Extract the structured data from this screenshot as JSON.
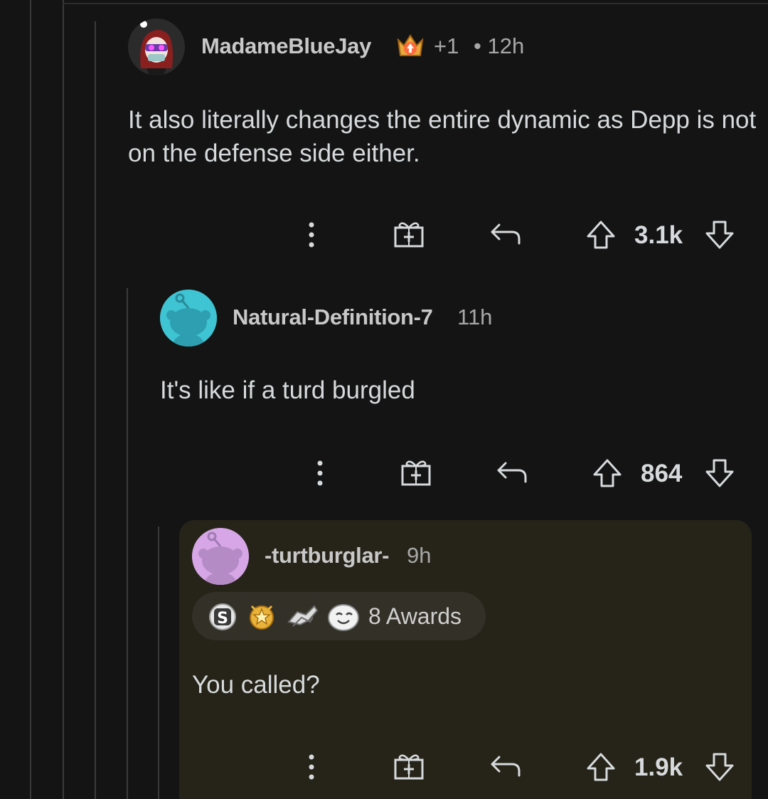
{
  "comments": [
    {
      "username": "MadameBlueJay",
      "flair_extra": "+1",
      "time": "• 12h",
      "body": "It also literally changes the entire dynamic as Depp is not on the defense side either.",
      "score": "3.1k"
    },
    {
      "username": "Natural-Definition-7",
      "time": "11h",
      "body": "It's like if a turd burgled",
      "score": "864"
    },
    {
      "username": "-turtburglar-",
      "time": "9h",
      "awards_label": "8 Awards",
      "body": "You called?",
      "score": "1.9k"
    }
  ],
  "colors": {
    "background": "#141414",
    "highlight": "#262419",
    "avatar_teal": "#3fc4d4",
    "avatar_purple": "#d6a6e6"
  }
}
